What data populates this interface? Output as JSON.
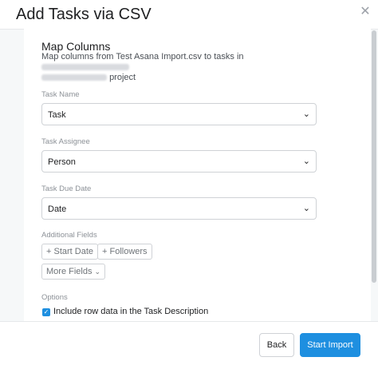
{
  "modal": {
    "title": "Add Tasks via CSV",
    "close_icon": "close-icon"
  },
  "section": {
    "title": "Map Columns",
    "desc_prefix": "Map columns from Test Asana Import.csv to tasks in",
    "desc_suffix": "project"
  },
  "fields": {
    "task_name": {
      "label": "Task Name",
      "value": "Task"
    },
    "task_assignee": {
      "label": "Task Assignee",
      "value": "Person"
    },
    "task_due_date": {
      "label": "Task Due Date",
      "value": "Date"
    }
  },
  "additional": {
    "label": "Additional Fields",
    "start_date": "+ Start Date",
    "followers": "+ Followers",
    "more_fields": "More Fields"
  },
  "options": {
    "label": "Options",
    "include_row_data": "Include row data in the Task Description",
    "include_row_data_checked": true
  },
  "footer": {
    "back": "Back",
    "start_import": "Start Import"
  },
  "colors": {
    "accent": "#1e8fe0",
    "panel_bg": "#f6f8f9"
  }
}
